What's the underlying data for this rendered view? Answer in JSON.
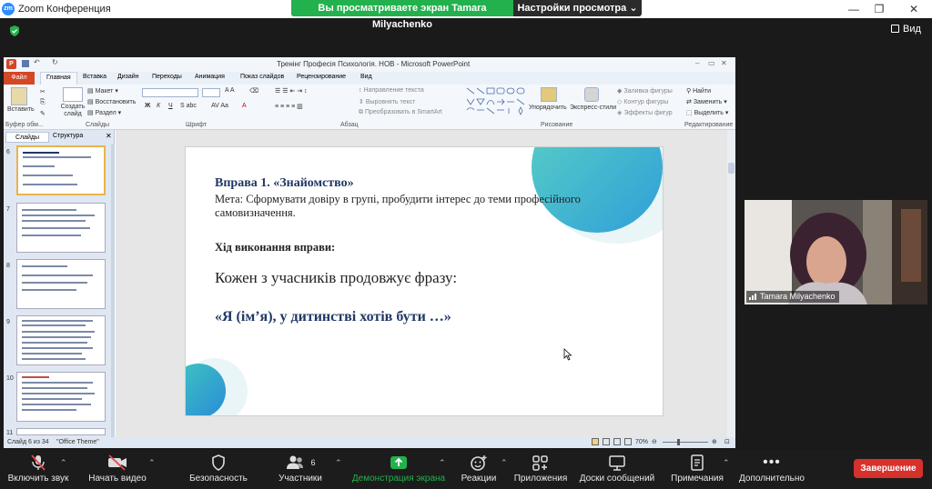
{
  "window": {
    "app_logo": "zm",
    "title": "Zoom Конференция"
  },
  "share_banner": {
    "message": "Вы просматриваете экран Tamara Milyachenko",
    "view_options": "Настройки просмотра"
  },
  "view_button": "Вид",
  "ppt": {
    "title": "Тренінг Професія Психологія. НОВ  -  Microsoft PowerPoint",
    "tabs": [
      "Файл",
      "Главная",
      "Вставка",
      "Дизайн",
      "Переходы",
      "Анимация",
      "Показ слайдов",
      "Рецензирование",
      "Вид"
    ],
    "ribbon": {
      "paste": "Вставить",
      "create_slide": "Создать слайд",
      "layout": "Макет",
      "restore": "Восстановить",
      "section": "Раздел",
      "text_direction": "Направление текста",
      "align_text": "Выровнять текст",
      "convert_smartart": "Преобразовать в SmartArt",
      "arrange": "Упорядочить",
      "quick_styles": "Экспресс-стили",
      "shape_fill": "Заливка фигуры",
      "shape_outline": "Контур фигуры",
      "shape_effects": "Эффекты фигур",
      "find": "Найти",
      "replace": "Заменить",
      "select": "Выделить",
      "groups": [
        "Буфер обм...",
        "Слайды",
        "Шрифт",
        "Абзац",
        "Рисование",
        "Редактирование"
      ]
    },
    "panel_tabs": [
      "Слайды",
      "Структура"
    ],
    "thumb_numbers": [
      "6",
      "7",
      "8",
      "9",
      "10",
      "11"
    ],
    "status": {
      "slide": "Слайд 6 из 34",
      "theme": "\"Office Theme\"",
      "zoom": "70%"
    },
    "slide": {
      "heading": "Вправа 1. «Знайомство»",
      "goal": "Мета: Сформувати довіру в групі, пробудити інтерес до теми професійного самовизначення.",
      "procedure": "Хід виконання вправи:",
      "line1": "Кожен з учасників продовжує фразу:",
      "line2": "«Я (ім’я), у дитинстві хотів бути …»"
    }
  },
  "video": {
    "name": "Tamara Milyachenko"
  },
  "toolbar": {
    "unmute": "Включить звук",
    "start_video": "Начать видео",
    "security": "Безопасность",
    "participants": "Участники",
    "participants_count": "6",
    "share_screen": "Демонстрация экрана",
    "reactions": "Реакции",
    "apps": "Приложения",
    "whiteboards": "Доски сообщений",
    "notes": "Примечания",
    "more": "Дополнительно",
    "end": "Завершение"
  },
  "colors": {
    "share_green": "#23b14d",
    "end_red": "#d7312c",
    "slide_heading": "#1f3864",
    "zoom_blue": "#2d8cff"
  }
}
